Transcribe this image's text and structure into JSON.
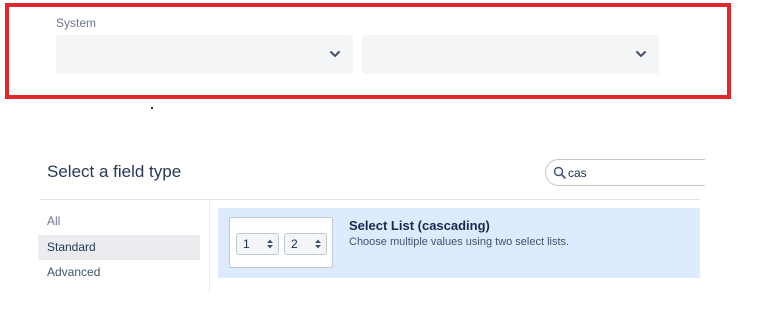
{
  "system_field": {
    "label": "System",
    "select_1_value": "",
    "select_2_value": ""
  },
  "dialog": {
    "title": "Select a field type",
    "search": {
      "value": "cas",
      "placeholder": ""
    },
    "nav": {
      "items": [
        {
          "label": "All",
          "selected": false
        },
        {
          "label": "Standard",
          "selected": true
        },
        {
          "label": "Advanced",
          "selected": false
        }
      ]
    },
    "results": [
      {
        "title": "Select List (cascading)",
        "description": "Choose multiple values using two select lists.",
        "preview": {
          "select_1": "1",
          "select_2": "2"
        }
      }
    ]
  },
  "colors": {
    "highlight_border": "#e1262c",
    "selected_row_bg": "#deebff",
    "nav_selected_bg": "#ebecf0"
  },
  "icons": [
    "chevron-down-icon",
    "search-icon",
    "up-down-arrows-icon"
  ]
}
